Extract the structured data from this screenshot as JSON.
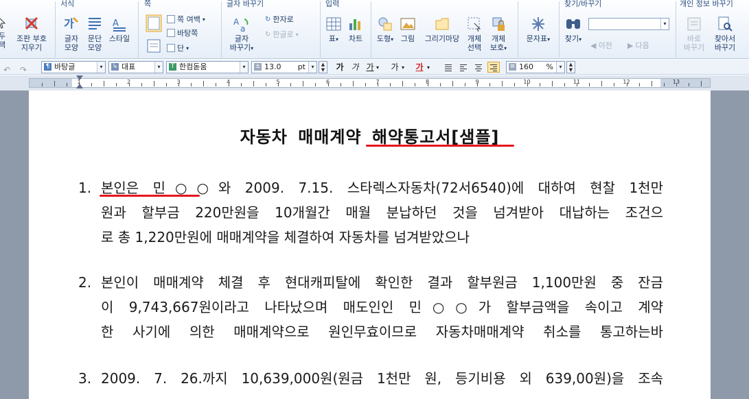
{
  "ribbon": {
    "groups": {
      "format": "서식",
      "page": "쪽",
      "font_change": "글자 바꾸기",
      "insert": "입력",
      "find_change": "찾기/바꾸기",
      "personal_info": "개인 정보 바꾸기"
    },
    "buttons": {
      "cut_fragment": "두\n택",
      "clear_format": "조판 부호\n지우기",
      "char_shape": "글자\n모양",
      "para_shape": "문단\n모양",
      "style": "스타일",
      "page_margin": "쪽 여백",
      "page_bg": "바탕쪽",
      "columns": "단",
      "char_change": "글자\n바꾸기",
      "hanja": "한자로",
      "hangul": "한글로",
      "table": "표",
      "chart": "차트",
      "shape": "도형",
      "picture": "그림",
      "draw_pad": "그리기마당",
      "object_select": "개체\n선택",
      "object_protect": "개체\n보호",
      "char_map": "문자표",
      "find": "찾기",
      "prev": "이전",
      "next": "다음",
      "change_now": "바로\n바꾸기",
      "find_change": "찾아서\n바꾸기"
    },
    "find_value": ""
  },
  "format_toolbar": {
    "style": "바탕글",
    "lang": "대표",
    "font": "한컴돋움",
    "size": "13.0",
    "size_unit": "pt",
    "bold": "가",
    "italic": "가",
    "underline": "가",
    "strike": "가",
    "color": "가",
    "line_spacing": "160",
    "line_spacing_unit": "%"
  },
  "ruler": {
    "numbers": [
      "1",
      "2",
      "3",
      "4",
      "5",
      "6",
      "7",
      "8",
      "9",
      "10",
      "11",
      "12",
      "13"
    ]
  },
  "document": {
    "title": "자동차 매매계약 해약통고서[샘플]",
    "paragraphs": [
      {
        "num": "1.",
        "lines": [
          "본인은 민○○와 2009. 7.15. 스타렉스자동차(72서6540)에 대하여 현찰 1천만",
          "원과 할부금 220만원을 10개월간 매월 분납하던 것을 넘겨받아 대납하는 조건으",
          "로 총 1,220만원에 매매계약을 체결하여 자동차를 넘겨받았으나"
        ]
      },
      {
        "num": "2.",
        "lines": [
          "본인이 매매계약 체결 후 현대캐피탈에 확인한 결과 할부원금 1,100만원 중 잔금",
          "이 9,743,667원이라고 나타났으며  매도인인 민○○가 할부금액을 속이고 계약",
          "한 사기에 의한 매매계약으로 원인무효이므로 자동차매매계약 취소를 통고하는바"
        ]
      },
      {
        "num": "3.",
        "lines": [
          "2009. 7. 26.까지 10,639,000원(원금 1천만 원, 등기비용 외 639,00원)을 조속"
        ]
      }
    ]
  },
  "colors": {
    "annotation_red": "#e8141c",
    "ribbon_text": "#1f3b66"
  }
}
